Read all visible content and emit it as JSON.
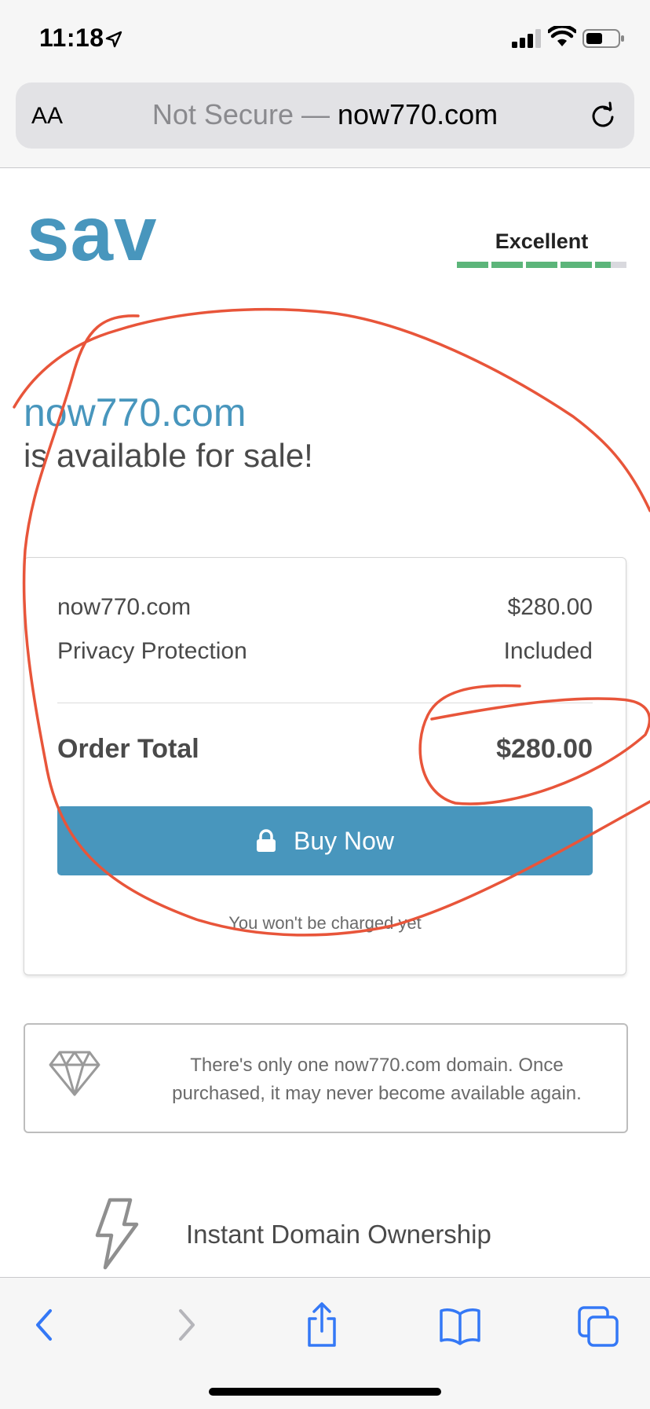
{
  "status_bar": {
    "time": "11:18"
  },
  "address_bar": {
    "text_size_button": "AA",
    "security_label": "Not Secure —",
    "domain": "now770.com"
  },
  "header": {
    "logo": "sav",
    "rating_label": "Excellent",
    "rating_segments": 5,
    "rating_value": 0.9
  },
  "headline": {
    "domain": "now770.com",
    "subtitle": "is available for sale!"
  },
  "order": {
    "items": [
      {
        "label": "now770.com",
        "value": "$280.00"
      },
      {
        "label": "Privacy Protection",
        "value": "Included"
      }
    ],
    "total_label": "Order Total",
    "total_value": "$280.00",
    "buy_button": "Buy Now",
    "note": "You won't be charged yet"
  },
  "uniqueness": {
    "text": "There's only one now770.com domain. Once purchased, it may never become available again."
  },
  "feature": {
    "title": "Instant Domain Ownership"
  },
  "colors": {
    "brand": "#4896bd",
    "rating_green": "#5cb57a",
    "annotation_red": "#e8553a",
    "ios_blue": "#3478f6"
  },
  "icons": {
    "status": [
      "location-arrow-icon",
      "cellular-signal-icon",
      "wifi-icon",
      "battery-icon"
    ],
    "address": [
      "reload-icon"
    ],
    "page": [
      "lock-icon",
      "diamond-icon",
      "lightning-bolt-icon"
    ],
    "toolbar": [
      "back-chevron-icon",
      "forward-chevron-icon",
      "share-icon",
      "bookmarks-icon",
      "tabs-icon"
    ]
  }
}
